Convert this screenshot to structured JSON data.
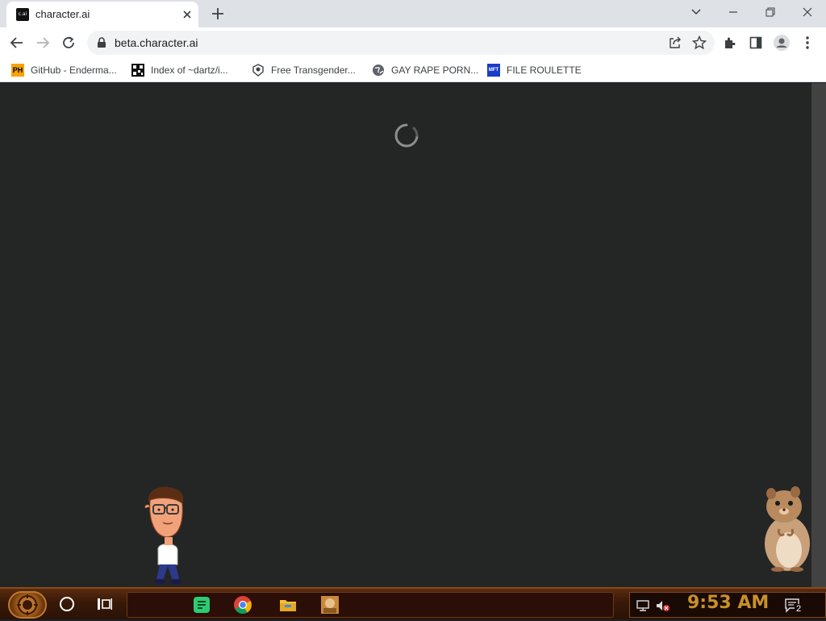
{
  "browser": {
    "tab": {
      "favicon_text": "c.ai",
      "title": "character.ai"
    },
    "url": "beta.character.ai"
  },
  "bookmarks": [
    {
      "label": "GitHub - Enderma...",
      "icon": "ph-icon",
      "icon_text": "PH"
    },
    {
      "label": "Index of ~dartz/i...",
      "icon": "qr-icon",
      "icon_text": ""
    },
    {
      "label": "Free Transgender...",
      "icon": "badge-icon",
      "icon_text": ""
    },
    {
      "label": "GAY RAPE PORN...",
      "icon": "globe-icon",
      "icon_text": ""
    },
    {
      "label": "FILE ROULETTE",
      "icon": "mft-icon",
      "icon_text": "MFT"
    }
  ],
  "page": {
    "state": "loading"
  },
  "taskbar": {
    "apps": [
      "notes-app-icon",
      "chrome-icon",
      "file-explorer-icon",
      "app-thumbnail-icon"
    ],
    "clock": "9:53 AM",
    "notifications_count": "2"
  },
  "colors": {
    "tabstrip": "#dee1e6",
    "content_bg": "#242525",
    "clock": "#c8902a",
    "taskbar": "#3a1a08"
  }
}
